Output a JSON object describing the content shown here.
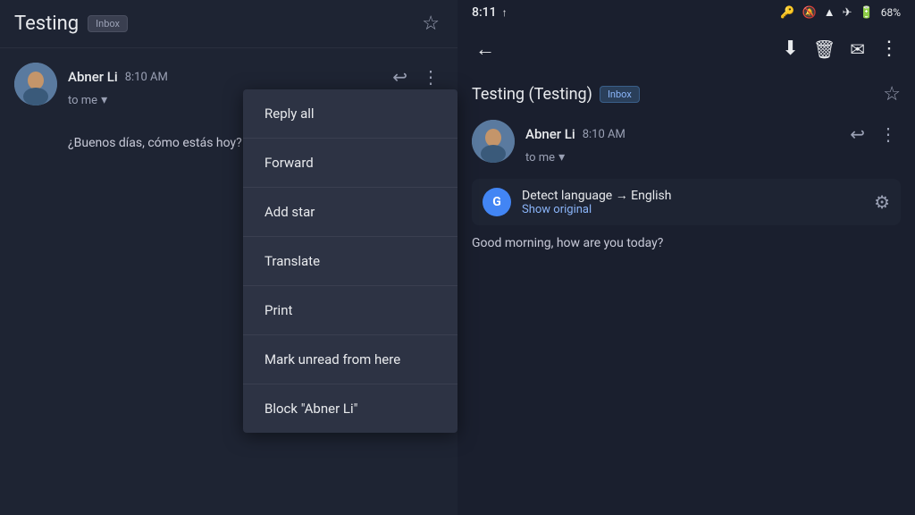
{
  "left_panel": {
    "title": "Testing",
    "inbox_badge": "Inbox",
    "sender": {
      "name": "Abner Li",
      "time": "8:10 AM",
      "to": "to me",
      "body": "¿Buenos días, cómo estás hoy?"
    },
    "dropdown": {
      "items": [
        "Reply all",
        "Forward",
        "Add star",
        "Translate",
        "Print",
        "Mark unread from here",
        "Block \"Abner Li\""
      ]
    }
  },
  "right_panel": {
    "status_bar": {
      "time": "8:11",
      "signal_icon": "↑",
      "battery": "68%"
    },
    "toolbar": {
      "back_label": "←",
      "archive_label": "⬇",
      "delete_label": "🗑",
      "mark_label": "✉",
      "more_label": "⋮"
    },
    "subject": "Testing (Testing)",
    "inbox_badge": "Inbox",
    "sender": {
      "name": "Abner Li",
      "time": "8:10 AM",
      "to": "to me"
    },
    "translate": {
      "label": "Detect language → English",
      "show_original": "Show original"
    },
    "body": "Good morning, how are you today?"
  },
  "icons": {
    "star": "☆",
    "reply": "↩",
    "more": "⋮",
    "back": "←",
    "archive": "⬇",
    "delete": "⬛",
    "mail": "✉",
    "gear": "⚙",
    "chevron_down": "▾",
    "translate": "G"
  }
}
